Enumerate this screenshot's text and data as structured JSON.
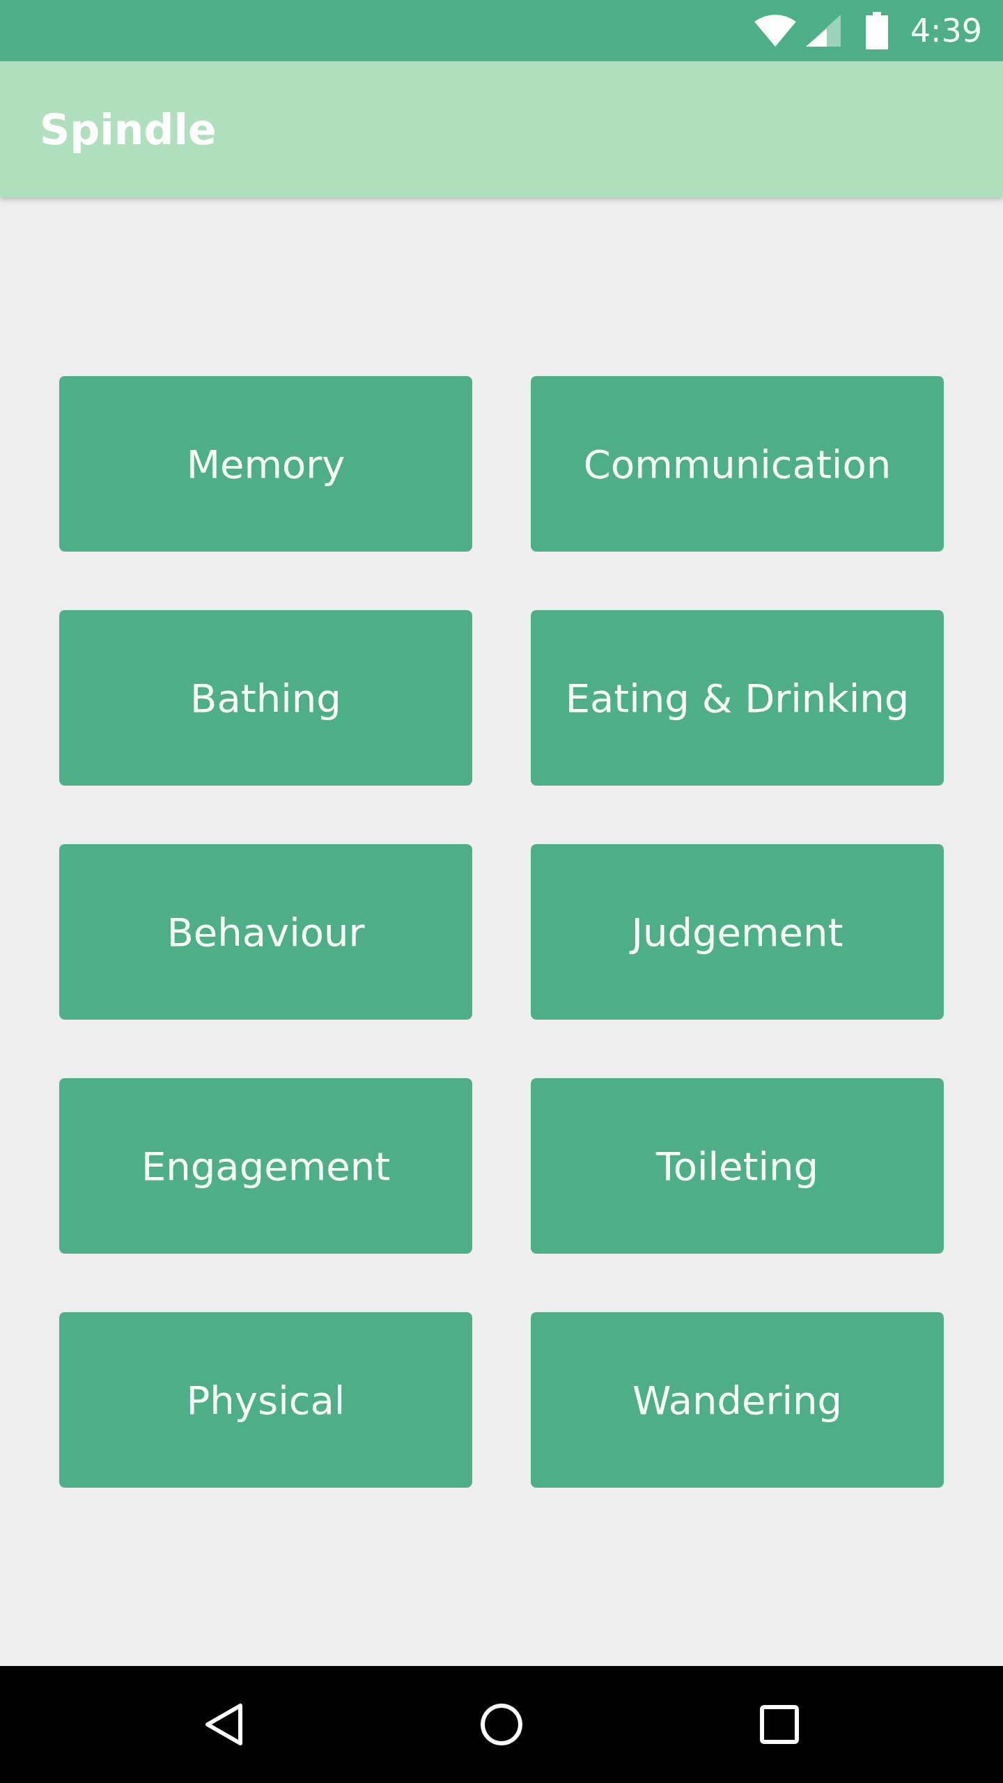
{
  "status_bar": {
    "time": "4:39"
  },
  "app_bar": {
    "title": "Spindle"
  },
  "categories": [
    {
      "label": "Memory"
    },
    {
      "label": "Communication"
    },
    {
      "label": "Bathing"
    },
    {
      "label": "Eating & Drinking"
    },
    {
      "label": "Behaviour"
    },
    {
      "label": "Judgement"
    },
    {
      "label": "Engagement"
    },
    {
      "label": "Toileting"
    },
    {
      "label": "Physical"
    },
    {
      "label": "Wandering"
    }
  ]
}
